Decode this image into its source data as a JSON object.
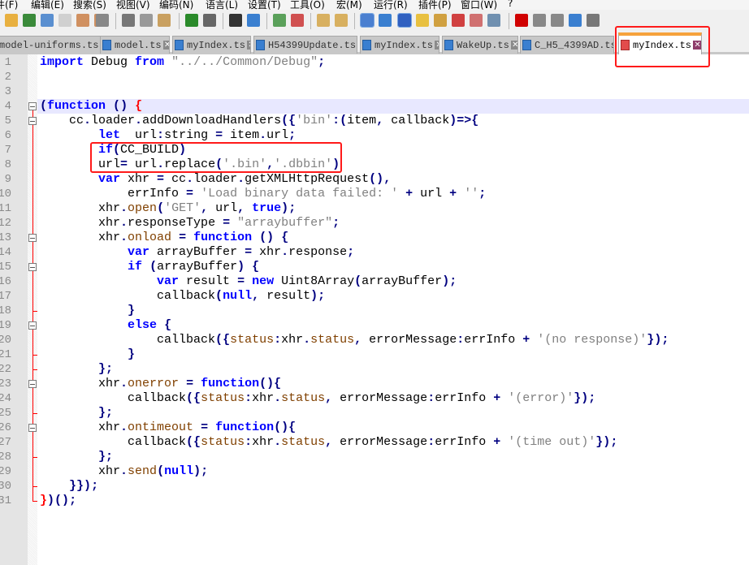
{
  "menu": [
    "件(F)",
    "编辑(E)",
    "搜索(S)",
    "视图(V)",
    "编码(N)",
    "语言(L)",
    "设置(T)",
    "工具(O)",
    "宏(M)",
    "运行(R)",
    "插件(P)",
    "窗口(W)",
    "?"
  ],
  "toolbar": [
    "new-file",
    "open-file",
    "save",
    "save-all",
    "close",
    "close-all",
    "print",
    "cut",
    "copy",
    "paste",
    "undo",
    "redo",
    "find",
    "replace",
    "zoom-in",
    "zoom-out",
    "sync-vertical",
    "sync-horizontal",
    "word-wrap",
    "show-all-chars",
    "indent-guide",
    "user-defined-language",
    "document-map",
    "function-list",
    "folder-as-workspace",
    "monitoring",
    "record-macro",
    "stop-record",
    "play-macro",
    "run-macro-multiple",
    "save-macro"
  ],
  "tabs": [
    {
      "label": "model-uniforms.ts"
    },
    {
      "label": "model.ts"
    },
    {
      "label": "myIndex.ts"
    },
    {
      "label": "H54399Update.ts"
    },
    {
      "label": "myIndex.ts"
    },
    {
      "label": "WakeUp.ts"
    },
    {
      "label": "C_H5_4399AD.ts"
    },
    {
      "label": "myIndex.ts",
      "active": true
    }
  ],
  "colors": {
    "keyword": "#0000ff",
    "operator": "#000080",
    "string": "#808080",
    "annotation": "#ff1a1a",
    "fold": "#ff0000"
  },
  "code": {
    "current_line": 4,
    "lines": [
      "import Debug from \"../../Common/Debug\";",
      "",
      "",
      "(function () {",
      "    cc.loader.addDownloadHandlers({'bin':(item, callback)=>{",
      "        let  url:string = item.url;",
      "        if(CC_BUILD)",
      "        url= url.replace('.bin','.dbbin')",
      "        var xhr = cc.loader.getXMLHttpRequest(),",
      "            errInfo = 'Load binary data failed: ' + url + '';",
      "        xhr.open('GET', url, true);",
      "        xhr.responseType = \"arraybuffer\";",
      "        xhr.onload = function () {",
      "            var arrayBuffer = xhr.response;",
      "            if (arrayBuffer) {",
      "                var result = new Uint8Array(arrayBuffer);",
      "                callback(null, result);",
      "            }",
      "            else {",
      "                callback({status:xhr.status, errorMessage:errInfo + '(no response)'});",
      "            }",
      "        };",
      "        xhr.onerror = function(){",
      "            callback({status:xhr.status, errorMessage:errInfo + '(error)'});",
      "        };",
      "        xhr.ontimeout = function(){",
      "            callback({status:xhr.status, errorMessage:errInfo + '(time out)'});",
      "        };",
      "        xhr.send(null);",
      "    }});",
      "})();"
    ]
  }
}
